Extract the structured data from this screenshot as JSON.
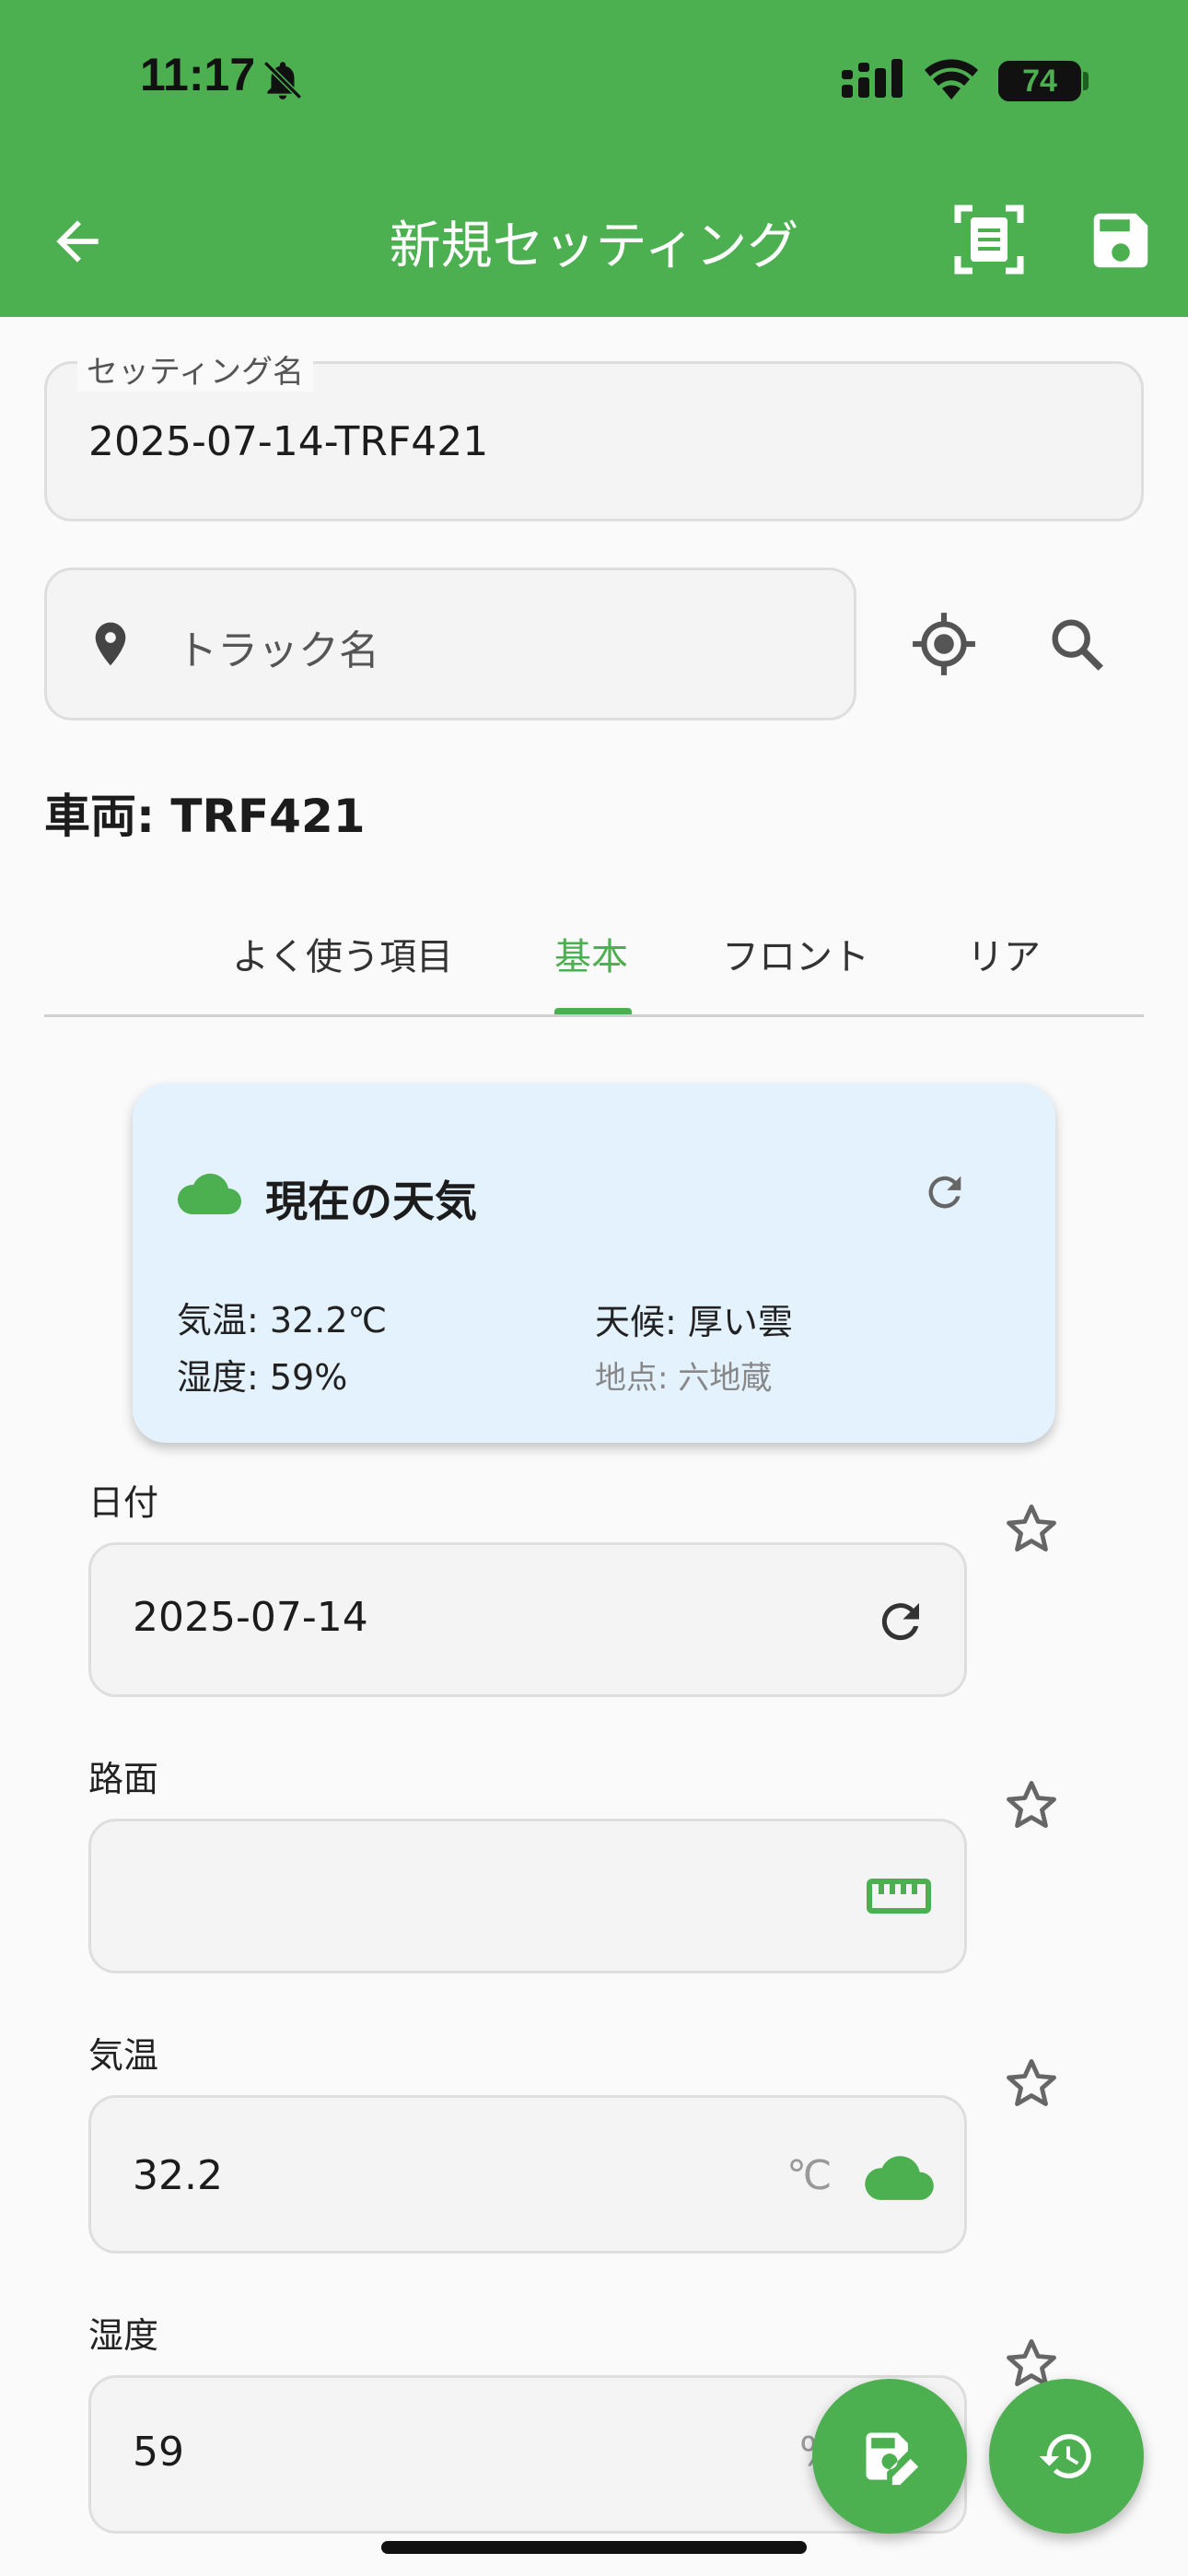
{
  "status_bar": {
    "time": "11:17",
    "battery": "74"
  },
  "app_bar": {
    "title": "新規セッティング"
  },
  "setting_name": {
    "label": "セッティング名",
    "value": "2025-07-14-TRF421"
  },
  "track": {
    "placeholder": "トラック名"
  },
  "vehicle": {
    "text": "車両: TRF421"
  },
  "tabs": [
    {
      "label": "よく使う項目",
      "active": false
    },
    {
      "label": "基本",
      "active": true
    },
    {
      "label": "フロント",
      "active": false
    },
    {
      "label": "リア",
      "active": false
    }
  ],
  "weather": {
    "title": "現在の天気",
    "temperature": "気温: 32.2℃",
    "humidity": "湿度: 59%",
    "condition": "天候: 厚い雲",
    "location": "地点: 六地蔵"
  },
  "fields": {
    "date": {
      "label": "日付",
      "value": "2025-07-14"
    },
    "surface": {
      "label": "路面",
      "value": ""
    },
    "temp": {
      "label": "気温",
      "value": "32.2",
      "suffix": "℃"
    },
    "humidity": {
      "label": "湿度",
      "value": "59",
      "suffix": "%"
    }
  },
  "colors": {
    "primary": "#4caf50",
    "weather_card": "#e3f2fd"
  }
}
